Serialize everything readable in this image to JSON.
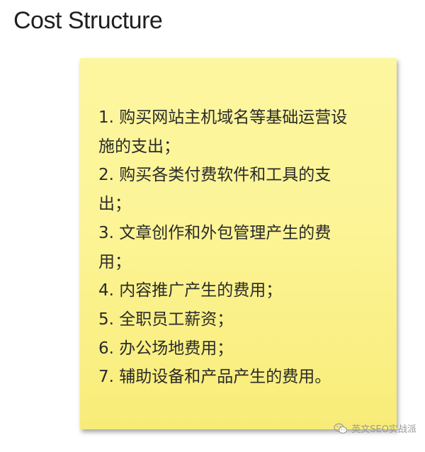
{
  "title": "Cost Structure",
  "items": [
    "1. 购买网站主机域名等基础运营设施的支出；",
    "2. 购买各类付费软件和工具的支出；",
    "3. 文章创作和外包管理产生的费用；",
    "4. 内容推广产生的费用；",
    "5. 全职员工薪资；",
    "6. 办公场地费用；",
    "7. 辅助设备和产品产生的费用。"
  ],
  "watermark": {
    "icon": "wechat-icon",
    "text": "英文SEO实战派"
  },
  "colors": {
    "note_top": "#fdf6a0",
    "note_bottom": "#f8ec78",
    "text": "#2a2a2a"
  }
}
